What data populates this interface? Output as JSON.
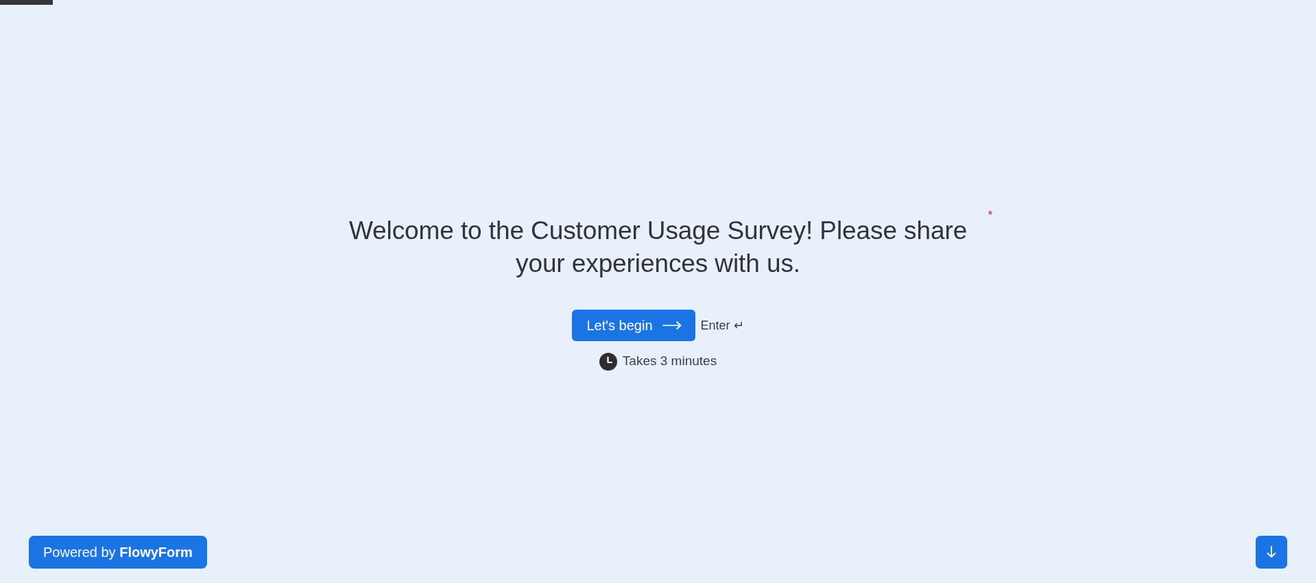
{
  "heading": {
    "text": "Welcome to the Customer Usage Survey! Please share your experiences with us.",
    "required_mark": "*"
  },
  "start_button": {
    "label": "Let's begin"
  },
  "key_hint": "Enter ↵",
  "duration": "Takes 3 minutes",
  "footer": {
    "powered_by": "Powered by **FlowyForm**"
  }
}
